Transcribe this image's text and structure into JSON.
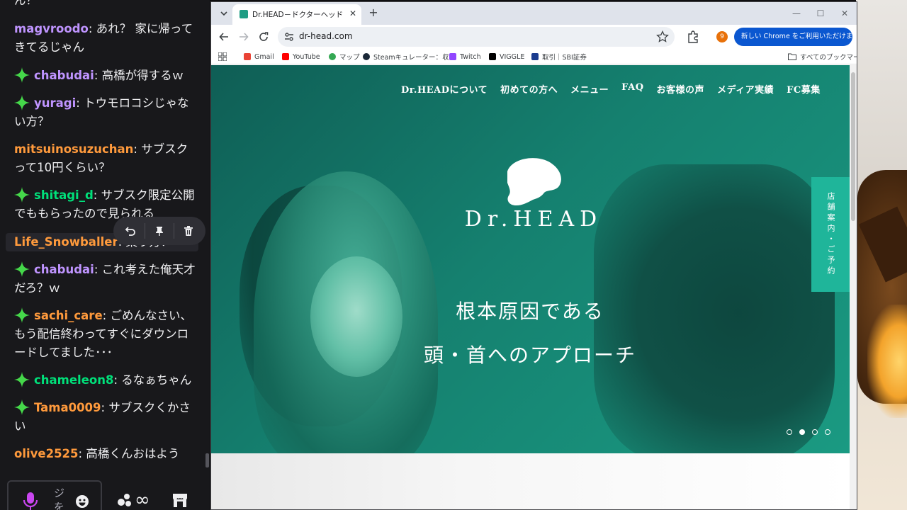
{
  "chat": {
    "top_fragment": "ん？",
    "messages": [
      {
        "user": "magvroodo",
        "sep": ": ",
        "text": "あれ？ 家に帰ってきてるじゃん",
        "color": "#bf94ff",
        "badge": false
      },
      {
        "user": "chabudai",
        "sep": ": ",
        "text": "高橋が得するｗ",
        "color": "#bf94ff",
        "badge": true
      },
      {
        "user": "yuragi",
        "sep": ": ",
        "text": "トウモロコシじゃない方？",
        "color": "#bf94ff",
        "badge": true
      },
      {
        "user": "mitsuinosuzuchan",
        "sep": ": ",
        "text": "サブスクって10円くらい？",
        "color": "#ff9a3c",
        "badge": false
      },
      {
        "user": "shitagi_d",
        "sep": ": ",
        "text": "サブスク限定公開でももらったので見られる",
        "color": "#00e07a",
        "badge": true
      },
      {
        "user": "Life_Snowballer",
        "sep": ": ",
        "text": "案り方？",
        "color": "#ff9a3c",
        "badge": false
      },
      {
        "user": "chabudai",
        "sep": ": ",
        "text": "これ考えた俺天才だろ？ｗ",
        "color": "#bf94ff",
        "badge": true
      },
      {
        "user": "sachi_care",
        "sep": ": ",
        "text": "ごめんなさい、もう配信終わってすぐにダウンロードしてました･･･",
        "color": "#ff9a3c",
        "badge": true
      },
      {
        "user": "chameleon8",
        "sep": ": ",
        "text": "るなぁちゃん",
        "color": "#00e07a",
        "badge": true
      },
      {
        "user": "Tama0009",
        "sep": ": ",
        "text": "サブスクくかさい",
        "color": "#ff9a3c",
        "badge": true
      },
      {
        "user": "olive2525",
        "sep": ": ",
        "text": "高橋くんおはよう",
        "color": "#ff9a3c",
        "badge": false
      }
    ],
    "input_typed": "ジを",
    "infinity_label": "∞"
  },
  "browser": {
    "tab_title": "Dr.HEAD－ドクターヘッド【首肩こり",
    "url": "dr-head.com",
    "profile_initial": "9",
    "update_label": "新しい Chrome をご利用いただけます",
    "bookmarks": [
      "Gmail",
      "YouTube",
      "マップ",
      "Steamキュレーター：収...",
      "Twitch",
      "VIGGLE",
      "取引｜SBI証券"
    ],
    "all_bookmarks": "すべてのブックマーク",
    "colors": {
      "brand_teal": "#1a9a82",
      "store_tab": "#1fb59a",
      "update_blue": "#0b57d0"
    }
  },
  "site": {
    "nav": [
      "Dr.HEADについて",
      "初めての方へ",
      "メニュー",
      "FAQ",
      "お客様の声",
      "メディア実績",
      "FC募集"
    ],
    "logo": "Dr.HEAD",
    "copy_line1": "根本原因である",
    "copy_line2": "頭・首へのアプローチ",
    "store_tab": "店舗案内・ご予約",
    "slider_active_index": 1,
    "slider_count": 4
  }
}
